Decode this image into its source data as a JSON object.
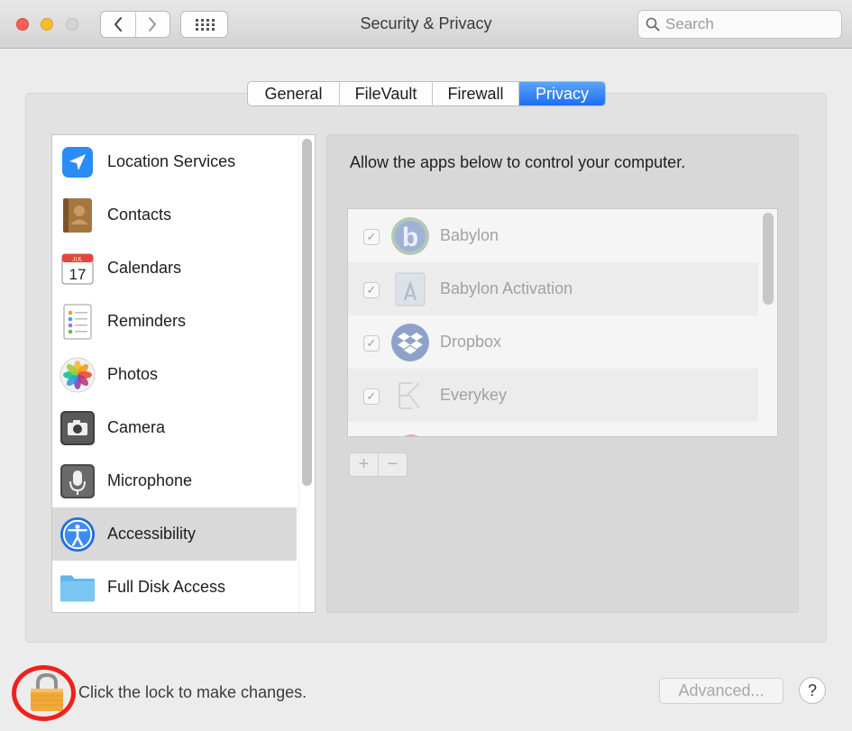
{
  "window": {
    "title": "Security & Privacy"
  },
  "toolbar": {
    "back_icon": "chevron-left-icon",
    "forward_icon": "chevron-right-icon",
    "show_all_icon": "grid-icon",
    "search_placeholder": "Search",
    "search_value": ""
  },
  "tabs": [
    {
      "label": "General",
      "active": false
    },
    {
      "label": "FileVault",
      "active": false
    },
    {
      "label": "Firewall",
      "active": false
    },
    {
      "label": "Privacy",
      "active": true
    }
  ],
  "sidebar": {
    "items": [
      {
        "label": "Location Services",
        "icon": "location-arrow-icon",
        "selected": false
      },
      {
        "label": "Contacts",
        "icon": "contacts-book-icon",
        "selected": false
      },
      {
        "label": "Calendars",
        "icon": "calendar-icon",
        "icon_text": "17",
        "icon_month": "JUL",
        "selected": false
      },
      {
        "label": "Reminders",
        "icon": "reminders-list-icon",
        "selected": false
      },
      {
        "label": "Photos",
        "icon": "photos-flower-icon",
        "selected": false
      },
      {
        "label": "Camera",
        "icon": "camera-icon",
        "selected": false
      },
      {
        "label": "Microphone",
        "icon": "microphone-icon",
        "selected": false
      },
      {
        "label": "Accessibility",
        "icon": "accessibility-icon",
        "selected": true
      },
      {
        "label": "Full Disk Access",
        "icon": "folder-icon",
        "selected": false
      }
    ]
  },
  "main": {
    "description": "Allow the apps below to control your computer.",
    "apps": [
      {
        "name": "Babylon",
        "checked": true,
        "icon": "babylon-icon",
        "icon_text": "b"
      },
      {
        "name": "Babylon Activation",
        "checked": true,
        "icon": "installer-icon"
      },
      {
        "name": "Dropbox",
        "checked": true,
        "icon": "dropbox-icon"
      },
      {
        "name": "Everykey",
        "checked": true,
        "icon": "everykey-icon"
      }
    ],
    "add_label": "+",
    "remove_label": "−"
  },
  "footer": {
    "lock_text": "Click the lock to make changes.",
    "advanced_label": "Advanced...",
    "help_label": "?"
  },
  "colors": {
    "accent": "#1c6ff2",
    "highlight_ring": "#f0211b",
    "close": "#fc5f57",
    "minimize": "#fdbc2e"
  }
}
